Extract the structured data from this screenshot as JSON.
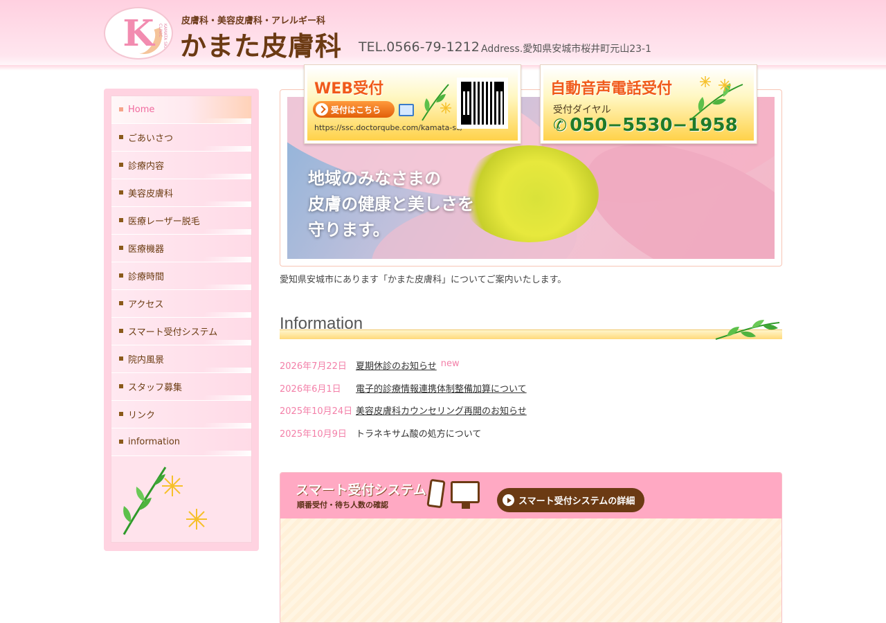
{
  "header": {
    "logo_text": "K",
    "logo_ring": "KAMATA SKIN CLINIC",
    "tagline": "皮膚科・美容皮膚科・アレルギー科",
    "clinic_name": "かまた皮膚科",
    "tel": "TEL.0566-79-1212",
    "address": "Address.愛知県安城市桜井町元山23-1"
  },
  "sidebar": {
    "items": [
      {
        "label": "Home",
        "active": true
      },
      {
        "label": "ごあいさつ"
      },
      {
        "label": "診療内容"
      },
      {
        "label": "美容皮膚科"
      },
      {
        "label": "医療レーザー脱毛"
      },
      {
        "label": "医療機器"
      },
      {
        "label": "診療時間"
      },
      {
        "label": "アクセス"
      },
      {
        "label": "スマート受付システム"
      },
      {
        "label": "院内風景"
      },
      {
        "label": "スタッフ募集"
      },
      {
        "label": "リンク"
      },
      {
        "label": "information"
      }
    ]
  },
  "hero": {
    "lines": [
      "地域のみなさまの",
      "皮膚の健康と美しさを",
      "守ります。"
    ]
  },
  "intro": "愛知県安城市にあります「かまた皮膚科」についてご案内いたします。",
  "information": {
    "title": "Information",
    "news": [
      {
        "date": "2026年7月22日",
        "title": "夏期休診のお知らせ",
        "badge": "new",
        "link": true
      },
      {
        "date": "2026年6月1日",
        "title": "電子的診療情報連携体制整備加算について",
        "badge": "",
        "link": true
      },
      {
        "date": "2025年10月24日",
        "title": "美容皮膚科カウンセリング再開のお知らせ",
        "badge": "",
        "link": true
      },
      {
        "date": "2025年10月9日",
        "title": "トラネキサム酸の処方について",
        "badge": "",
        "link": false
      }
    ]
  },
  "smart": {
    "title": "スマート受付システム",
    "subtitle": "順番受付・待ち人数の確認",
    "detail_button": "スマート受付システムの詳細",
    "web": {
      "title": "WEB受付",
      "button": "受付はこちら",
      "url": "https://ssc.doctorqube.com/kamata-sc/"
    },
    "phone": {
      "title": "自動音声電話受付",
      "label": "受付ダイヤル",
      "number": "050−5530−1958"
    }
  },
  "colors": {
    "accent_pink": "#f37fa8",
    "brown": "#6b3a13",
    "header_pink": "#ffd0e0"
  }
}
